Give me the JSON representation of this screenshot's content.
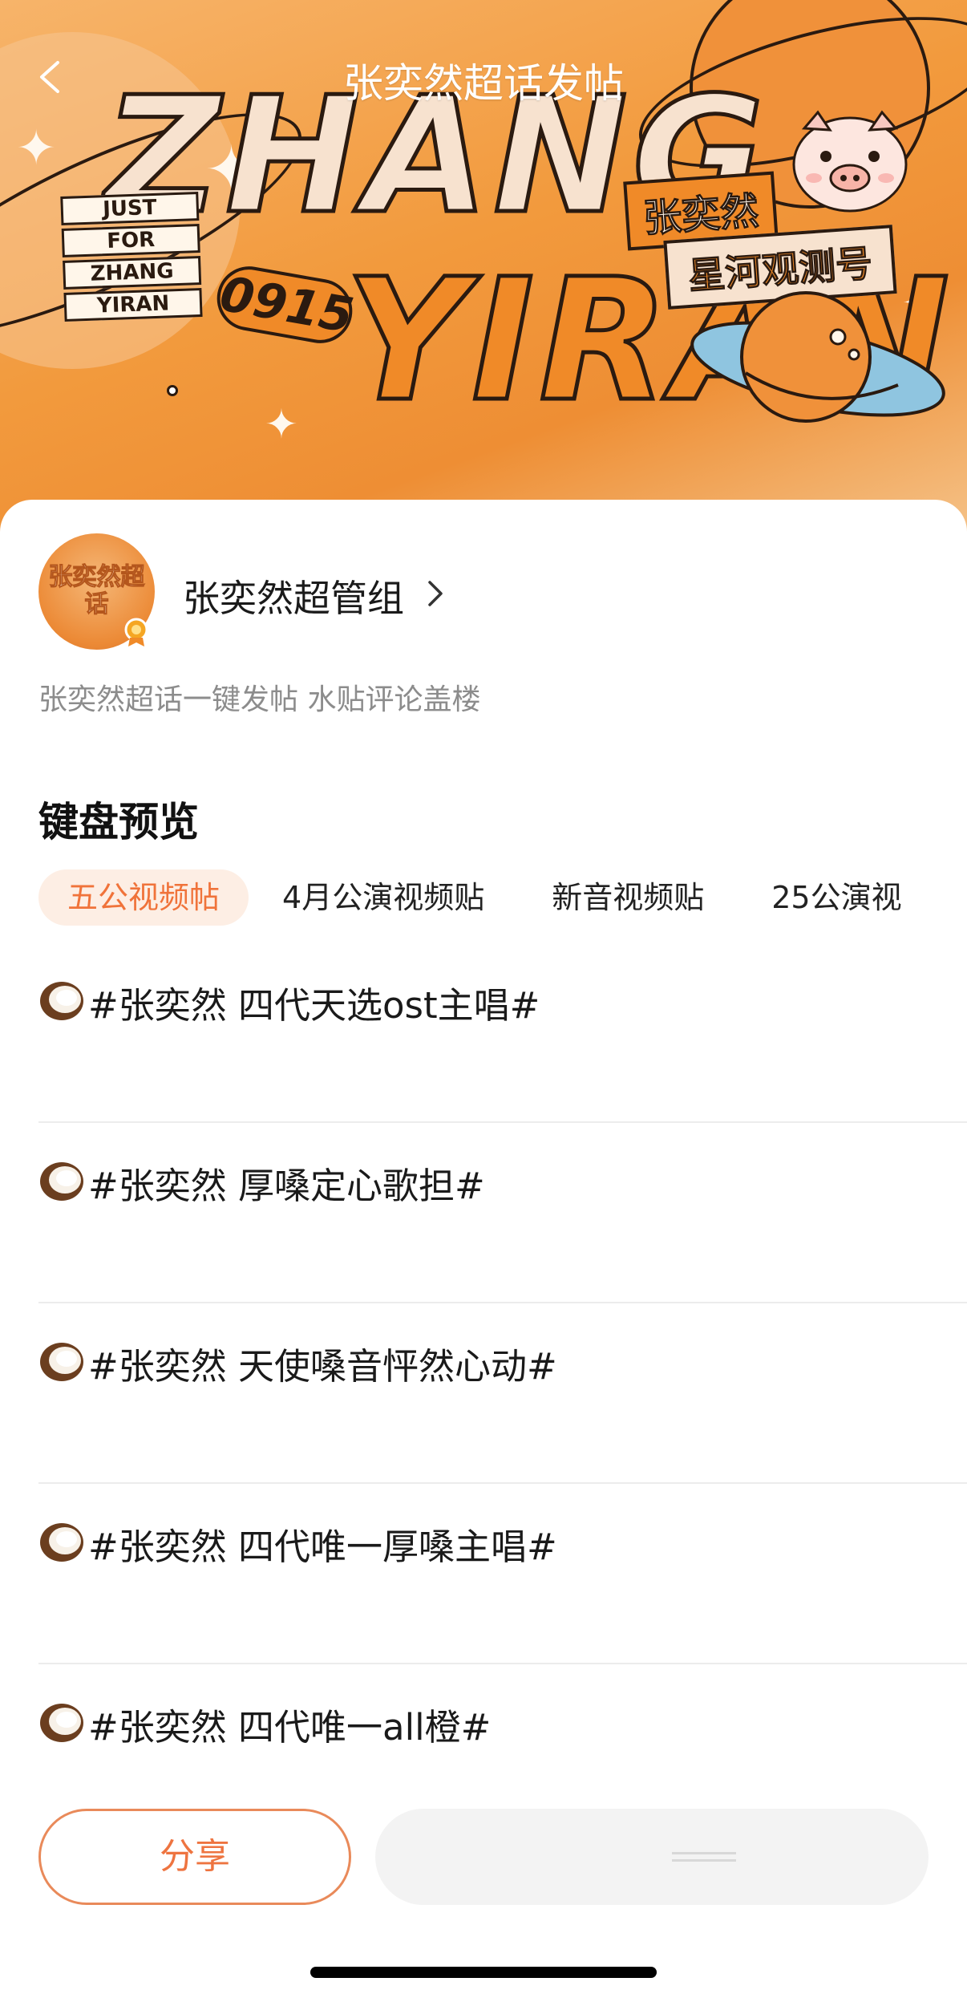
{
  "header": {
    "title": "张奕然超话发帖",
    "back_icon": "chevron-left-icon"
  },
  "banner": {
    "word_top": "ZHANG",
    "word_bottom": "YIRAN",
    "tag_lines": [
      "JUST",
      "FOR",
      "ZHANG",
      "YIRAN"
    ],
    "date": "0915",
    "name_cn": "张奕然",
    "subtitle_cn": "星河观测号",
    "accent_color": "#f08a28"
  },
  "owner": {
    "avatar_text": "张奕然超话",
    "name": "张奕然超管组",
    "description": "张奕然超话一键发帖 水贴评论盖楼"
  },
  "keyboard": {
    "section_title": "键盘预览",
    "tabs": [
      {
        "label": "五公视频帖",
        "active": true
      },
      {
        "label": "4月公演视频贴",
        "active": false
      },
      {
        "label": "新音视频贴",
        "active": false
      },
      {
        "label": "25公演视",
        "active": false
      }
    ],
    "posts": [
      {
        "icon": "coconut-icon",
        "text": "#张奕然 四代天选ost主唱#"
      },
      {
        "icon": "coconut-icon",
        "text": "#张奕然 厚嗓定心歌担#"
      },
      {
        "icon": "coconut-icon",
        "text": "#张奕然 天使嗓音怦然心动#"
      },
      {
        "icon": "coconut-icon",
        "text": "#张奕然 四代唯一厚嗓主唱#"
      },
      {
        "icon": "coconut-icon",
        "text": "#张奕然 四代唯一all橙#"
      }
    ]
  },
  "footer": {
    "share_label": "分享",
    "accent_color": "#ee7440"
  }
}
